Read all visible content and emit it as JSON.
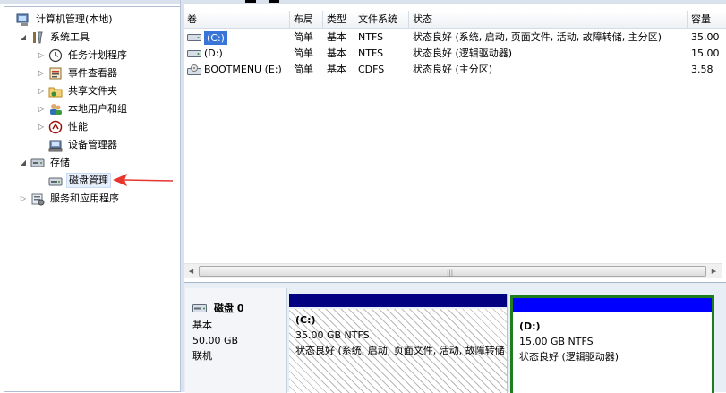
{
  "tree": {
    "items": [
      {
        "label": "计算机管理(本地)",
        "icon": "computer-management-icon",
        "expander": ""
      },
      {
        "label": "系统工具",
        "icon": "tools-icon",
        "expander": "◢"
      },
      {
        "label": "任务计划程序",
        "icon": "clock-icon",
        "expander": "▷"
      },
      {
        "label": "事件查看器",
        "icon": "event-viewer-icon",
        "expander": "▷"
      },
      {
        "label": "共享文件夹",
        "icon": "shared-folder-icon",
        "expander": "▷"
      },
      {
        "label": "本地用户和组",
        "icon": "users-icon",
        "expander": "▷"
      },
      {
        "label": "性能",
        "icon": "performance-icon",
        "expander": "▷"
      },
      {
        "label": "设备管理器",
        "icon": "device-manager-icon",
        "expander": ""
      },
      {
        "label": "存储",
        "icon": "storage-icon",
        "expander": "◢"
      },
      {
        "label": "磁盘管理",
        "icon": "disk-management-icon",
        "expander": ""
      },
      {
        "label": "服务和应用程序",
        "icon": "services-icon",
        "expander": "▷"
      }
    ]
  },
  "volume_list": {
    "columns": [
      "卷",
      "布局",
      "类型",
      "文件系统",
      "状态",
      "容量"
    ],
    "rows": [
      {
        "name": "(C:)",
        "layout": "简单",
        "type": "基本",
        "fs": "NTFS",
        "status": "状态良好 (系统, 启动, 页面文件, 活动, 故障转储, 主分区)",
        "capacity": "35.00"
      },
      {
        "name": "(D:)",
        "layout": "简单",
        "type": "基本",
        "fs": "NTFS",
        "status": "状态良好 (逻辑驱动器)",
        "capacity": "15.00"
      },
      {
        "name": "BOOTMENU (E:)",
        "layout": "简单",
        "type": "基本",
        "fs": "CDFS",
        "status": "状态良好 (主分区)",
        "capacity": "3.58"
      }
    ]
  },
  "scrollbar": {
    "left_arrow": "◀",
    "grip": "|||",
    "right_arrow": "▶"
  },
  "disk": {
    "name": "磁盘 0",
    "type": "基本",
    "size": "50.00 GB",
    "state": "联机",
    "partitions": [
      {
        "label": "(C:)",
        "size_fs": "35.00 GB NTFS",
        "status": "状态良好 (系统, 启动, 页面文件, 活动, 故障转储"
      },
      {
        "label": "(D:)",
        "size_fs": "15.00 GB NTFS",
        "status": "状态良好 (逻辑驱动器)"
      }
    ]
  },
  "colors": {
    "primary_partition_bar": "#000080",
    "logical_partition_bar": "#0000ff",
    "selected_partition_border": "#1e7d1e",
    "annotation_arrow": "#e8352e"
  }
}
